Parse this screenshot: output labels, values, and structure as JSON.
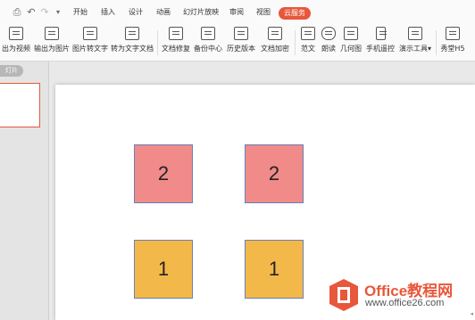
{
  "menu": {
    "items": [
      "开始",
      "插入",
      "设计",
      "动画",
      "幻灯片放映",
      "审阅",
      "视图",
      "云服务"
    ]
  },
  "ribbon": {
    "buttons": [
      "出为视频",
      "输出为图片",
      "图片转文字",
      "转为文字文档",
      "文档修复",
      "备份中心",
      "历史版本",
      "文档加密",
      "范文",
      "朗读",
      "几何图",
      "手机遥控",
      "演示工具",
      "秀堂H5"
    ],
    "dropdown_arrow": "▾"
  },
  "left_pane": {
    "tab_label": "灯片"
  },
  "slide": {
    "boxes": [
      {
        "value": "2",
        "color": "#f08b89"
      },
      {
        "value": "2",
        "color": "#f08b89"
      },
      {
        "value": "1",
        "color": "#f3b84a"
      },
      {
        "value": "1",
        "color": "#f3b84a"
      }
    ]
  },
  "watermark": {
    "brand": "Office教程网",
    "url": "www.office26.com"
  },
  "colors": {
    "accent": "#e8573b",
    "pink": "#f08b89",
    "orange": "#f3b84a"
  }
}
